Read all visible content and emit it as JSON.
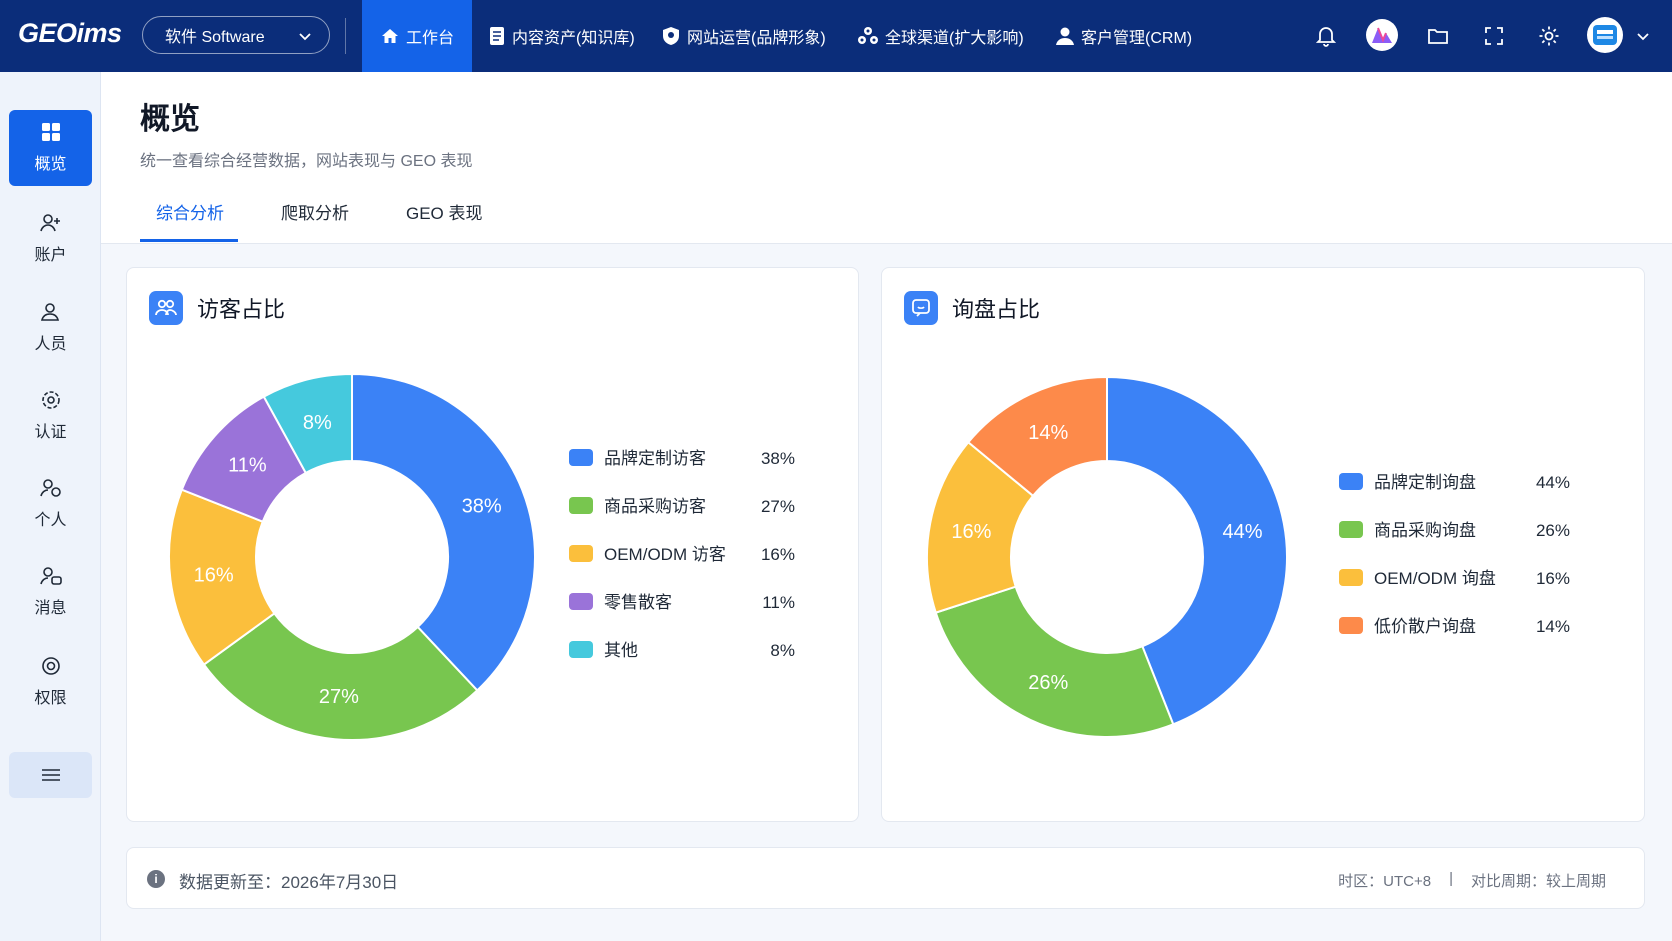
{
  "topbar": {
    "logo": "GEOims",
    "software_select": "软件 Software",
    "nav": [
      {
        "label": "工作台",
        "icon": "home-icon",
        "active": true
      },
      {
        "label": "内容资产(知识库)",
        "icon": "document-icon",
        "active": false
      },
      {
        "label": "网站运营(品牌形象)",
        "icon": "shield-icon",
        "active": false
      },
      {
        "label": "全球渠道(扩大影响)",
        "icon": "channels-icon",
        "active": false
      },
      {
        "label": "客户管理(CRM)",
        "icon": "user-icon",
        "active": false
      }
    ],
    "right_icons": [
      "bell-icon",
      "ai-avatar-icon",
      "folder-icon",
      "fullscreen-icon",
      "gear-icon",
      "company-avatar-icon",
      "chevron-down-icon"
    ]
  },
  "sidebar": {
    "items": [
      {
        "label": "概览",
        "icon": "grid-icon",
        "active": true
      },
      {
        "label": "账户",
        "icon": "user-add-icon",
        "active": false
      },
      {
        "label": "人员",
        "icon": "people-icon",
        "active": false
      },
      {
        "label": "认证",
        "icon": "settings-badge-icon",
        "active": false
      },
      {
        "label": "个人",
        "icon": "person-icon",
        "active": false
      },
      {
        "label": "消息",
        "icon": "message-person-icon",
        "active": false
      },
      {
        "label": "权限",
        "icon": "target-icon",
        "active": false
      }
    ],
    "toggle_icon": "menu-icon"
  },
  "page": {
    "title": "概览",
    "subtitle": "统一查看综合经营数据，网站表现与 GEO 表现",
    "tabs": [
      {
        "label": "综合分析",
        "active": true
      },
      {
        "label": "爬取分析",
        "active": false
      },
      {
        "label": "GEO 表现",
        "active": false
      }
    ]
  },
  "cards": {
    "visitors": {
      "title": "访客占比",
      "icon": "people-icon"
    },
    "inquiries": {
      "title": "询盘占比",
      "icon": "chat-icon"
    }
  },
  "chart_data": [
    {
      "type": "pie",
      "title": "访客占比",
      "categories": [
        "品牌定制访客",
        "商品采购访客",
        "OEM/ODM 访客",
        "零售散客",
        "其他"
      ],
      "values": [
        38,
        27,
        16,
        11,
        8
      ],
      "labels": [
        "38%",
        "27%",
        "16%",
        "11%",
        "8%"
      ],
      "colors": [
        "#3b82f6",
        "#78c64f",
        "#fbbf3c",
        "#9a73d9",
        "#45c9dd"
      ],
      "legend": "right"
    },
    {
      "type": "pie",
      "title": "询盘占比",
      "categories": [
        "品牌定制询盘",
        "商品采购询盘",
        "OEM/ODM 询盘",
        "低价散户询盘"
      ],
      "values": [
        44,
        26,
        16,
        14
      ],
      "labels": [
        "44%",
        "26%",
        "16%",
        "14%"
      ],
      "colors": [
        "#3b82f6",
        "#78c64f",
        "#fbbf3c",
        "#fd8a4a"
      ],
      "legend": "right"
    }
  ],
  "footer": {
    "update_text": "数据更新至：2026年7月30日",
    "timezone": "时区：UTC+8",
    "separator": "|",
    "compare": "对比周期：较上周期"
  }
}
